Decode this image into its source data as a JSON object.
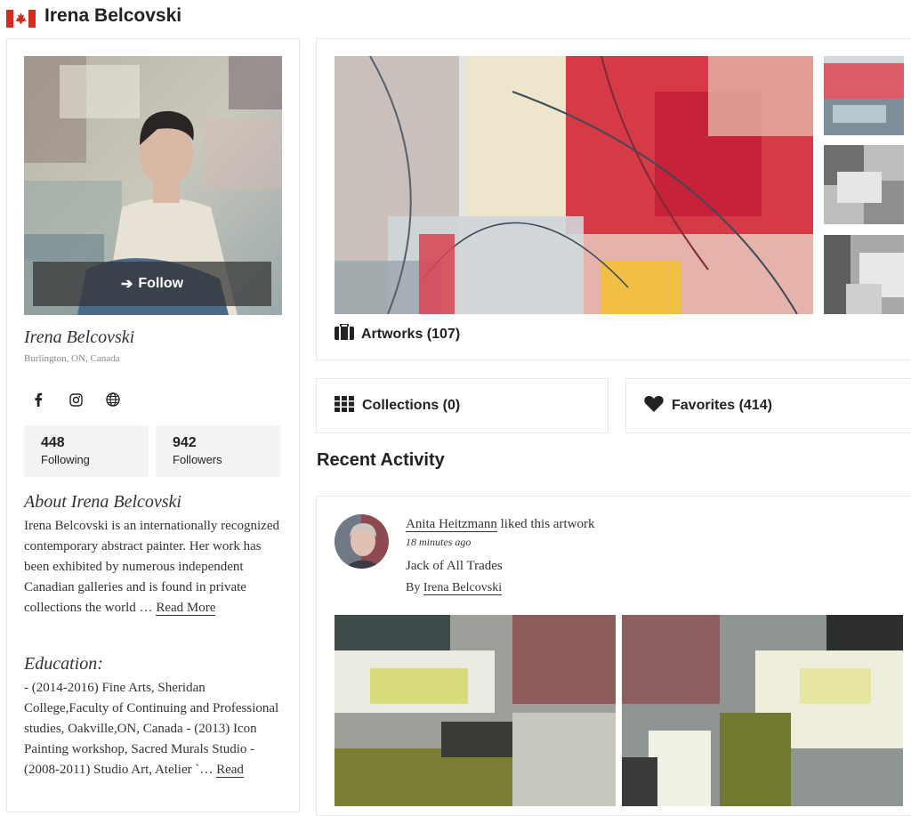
{
  "header": {
    "title": "Irena Belcovski",
    "flag_icon": "canada-flag-icon"
  },
  "profile": {
    "follow_label": "Follow",
    "name": "Irena Belcovski",
    "location": "Burlington, ON, Canada",
    "social_icons": [
      "facebook-icon",
      "instagram-icon",
      "globe-icon"
    ],
    "stats": [
      {
        "value": "448",
        "label": "Following"
      },
      {
        "value": "942",
        "label": "Followers"
      }
    ],
    "about_title": "About Irena Belcovski",
    "about_text": "Irena Belcovski is an internationally recognized contemporary abstract painter. Her work has been exhibited by numerous independent Canadian galleries and is found in private collections the world …",
    "read_more": "Read More",
    "education_title": "Education:",
    "education_text": "- (2014-2016) Fine Arts, Sheridan College,Faculty of Continuing and Professional studies, Oakville,ON, Canada - (2013) Icon Painting workshop, Sacred Murals Studio - (2008-2011) Studio Art, Atelier `…",
    "education_read": "Read"
  },
  "main": {
    "artworks_label": "Artworks (107)",
    "collections_label": "Collections (0)",
    "favorites_label": "Favorites (414)",
    "recent_activity_title": "Recent Activity"
  },
  "activity": {
    "user": "Anita Heitzmann",
    "action": " liked this artwork",
    "time": "18 minutes ago",
    "artwork_title": "Jack of All Trades",
    "by_prefix": "By ",
    "artist": "Irena Belcovski"
  },
  "colors": {
    "flag_red": "#d52b1e",
    "stat_bg": "#f3f3f1",
    "accent_red": "#d9434f"
  }
}
